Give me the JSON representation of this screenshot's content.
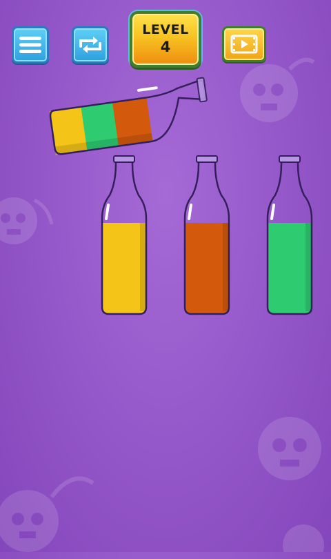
{
  "header": {
    "level_label": "LEVEL",
    "level_number": "4"
  },
  "icons": {
    "menu": "menu-icon",
    "restart": "restart-icon",
    "video": "video-icon",
    "background": "skull-bomb-icon"
  },
  "colors": {
    "background": "#9356c8",
    "yellow": "#f4c418",
    "green": "#2ecb71",
    "orange": "#d35a0c",
    "button_blue": "#3aaee8",
    "button_gold": "#f7c322"
  },
  "bottles": [
    {
      "id": "tilted",
      "layers": [
        "yellow",
        "green",
        "orange"
      ],
      "selected": true
    },
    {
      "id": "bottle-1",
      "layers": [
        "yellow"
      ],
      "fill_fraction": 0.6
    },
    {
      "id": "bottle-2",
      "layers": [
        "orange"
      ],
      "fill_fraction": 0.6
    },
    {
      "id": "bottle-3",
      "layers": [
        "green"
      ],
      "fill_fraction": 0.6
    }
  ]
}
